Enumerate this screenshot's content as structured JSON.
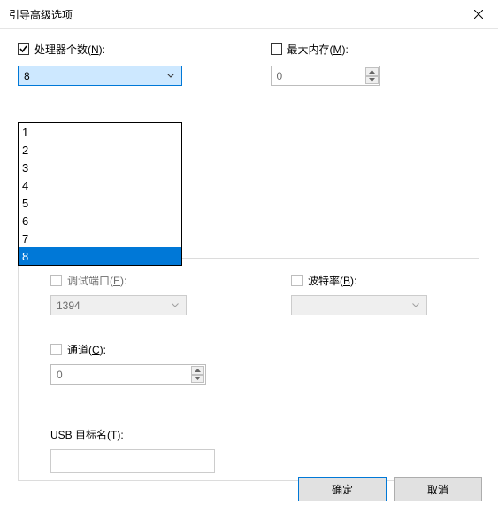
{
  "window": {
    "title": "引导高级选项"
  },
  "processor": {
    "label_pre": "处理器个数(",
    "accel": "N",
    "label_post": "):",
    "checked": true,
    "value": "8",
    "options": [
      "1",
      "2",
      "3",
      "4",
      "5",
      "6",
      "7",
      "8"
    ],
    "selected_index": 7
  },
  "memory": {
    "label_pre": "最大内存(",
    "accel": "M",
    "label_post": "):",
    "checked": false,
    "value": "0"
  },
  "debug_port": {
    "label_pre": "调试端口(",
    "accel": "E",
    "label_post": "):",
    "value": "1394",
    "enabled": false
  },
  "baud": {
    "label_pre": "波特率(",
    "accel": "B",
    "label_post": "):",
    "value": "",
    "enabled": false
  },
  "channel": {
    "label_pre": "通道(",
    "accel": "C",
    "label_post": "):",
    "value": "0",
    "enabled": false
  },
  "usb_target": {
    "label_pre": "USB 目标名(",
    "accel": "T",
    "label_post": "):",
    "value": ""
  },
  "buttons": {
    "ok": "确定",
    "cancel": "取消"
  }
}
